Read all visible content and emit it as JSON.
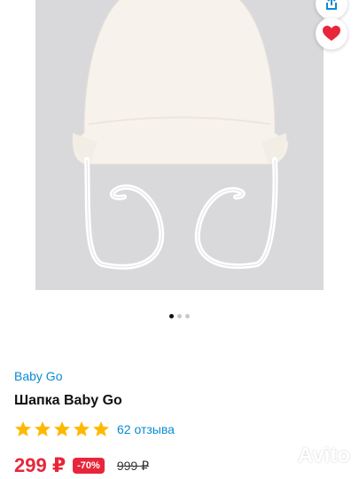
{
  "product": {
    "brand": "Baby Go",
    "title": "Шапка Baby Go",
    "rating": 5,
    "reviews_label": "62 отзыва",
    "price": "299 ₽",
    "discount": "-70%",
    "old_price": "999 ₽"
  },
  "gallery": {
    "active_index": 0,
    "count": 3
  },
  "icons": {
    "share": "share-icon",
    "favorite": "heart-icon",
    "star": "star-icon"
  },
  "watermark": {
    "text": "Avito"
  },
  "colors": {
    "accent_red": "#e8263b",
    "link_blue": "#0a8ad6",
    "star_yellow": "#ffb800"
  }
}
